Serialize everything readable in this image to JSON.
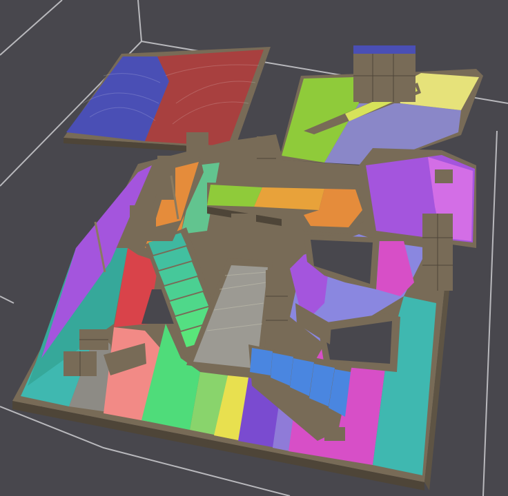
{
  "scene": {
    "kind": "3d-voxel-navmesh-visualization",
    "background_color": "#48474d",
    "bounding_box_color": "#b9b9bd",
    "wall_color": "#786b57",
    "wall_dark_color": "#4e4538",
    "region_colors": {
      "blue": "#4a4fb5",
      "red": "#a8403f",
      "lime": "#8fcb3a",
      "yellow": "#e6e27a",
      "lavender": "#8a87c8",
      "violet": "#a455dd",
      "pink_violet": "#d36ee6",
      "magenta": "#d74fc7",
      "cyan": "#3fb8b0",
      "teal": "#36a89a",
      "orange": "#e58c3b",
      "salmon": "#f28a86",
      "green": "#4fdc7a",
      "bright_yellow": "#e8e04f",
      "purple": "#7a4bd0",
      "sky_blue": "#4a86e0",
      "grey": "#8d8b85",
      "crimson": "#d9434a",
      "seafoam": "#62c48f",
      "light_green": "#89d46c"
    }
  }
}
